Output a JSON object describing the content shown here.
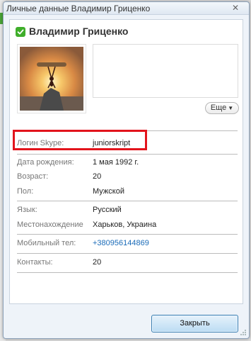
{
  "window": {
    "title": "Личные данные Владимир Гриценко",
    "close_icon": "close-icon"
  },
  "profile": {
    "name": "Владимир Гриценко",
    "status_icon": "check-icon",
    "more_label": "Еще"
  },
  "fields": {
    "skype": {
      "label": "Логин Skype:",
      "value": "juniorskript"
    },
    "birthday": {
      "label": "Дата рождения:",
      "value": "1 мая 1992 г."
    },
    "age": {
      "label": "Возраст:",
      "value": "20"
    },
    "gender": {
      "label": "Пол:",
      "value": "Мужской"
    },
    "language": {
      "label": "Язык:",
      "value": "Русский"
    },
    "location": {
      "label": "Местонахождение",
      "value": "Харьков, Украина"
    },
    "mobile": {
      "label": "Мобильный тел:",
      "value": "+380956144869"
    },
    "contacts": {
      "label": "Контакты:",
      "value": "20"
    }
  },
  "footer": {
    "close_label": "Закрыть"
  },
  "colors": {
    "highlight": "#e2141c",
    "link": "#1a6bb8",
    "status_green": "#3fae2a"
  }
}
